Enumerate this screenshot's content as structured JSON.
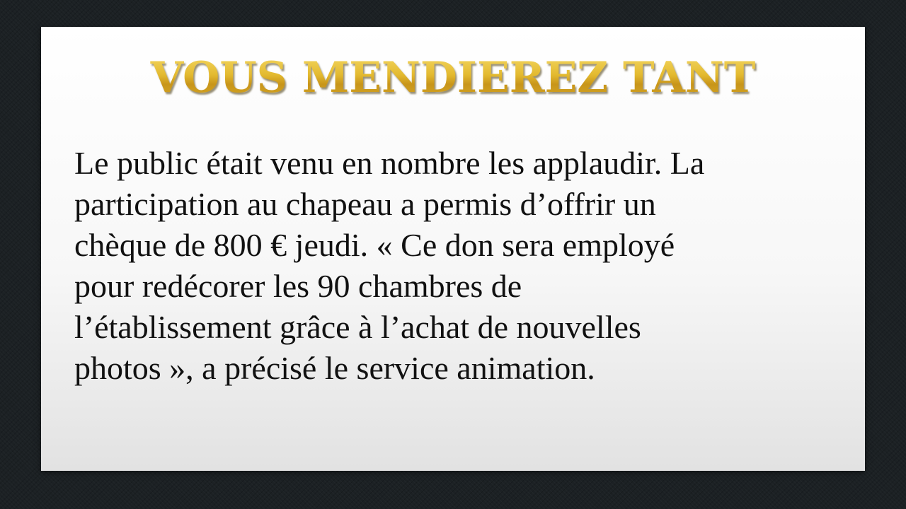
{
  "slide": {
    "title": "VOUS MENDIEREZ TANT",
    "body_lines": [
      "Le public était venu en nombre les applaudir. La",
      "participation au chapeau a permis d’offrir un",
      "chèque de 800 € jeudi. « Ce don sera employé",
      "pour redécorer les 90 chambres de",
      "l’établissement grâce à l’achat de nouvelles",
      "photos », a précisé le service animation."
    ]
  }
}
